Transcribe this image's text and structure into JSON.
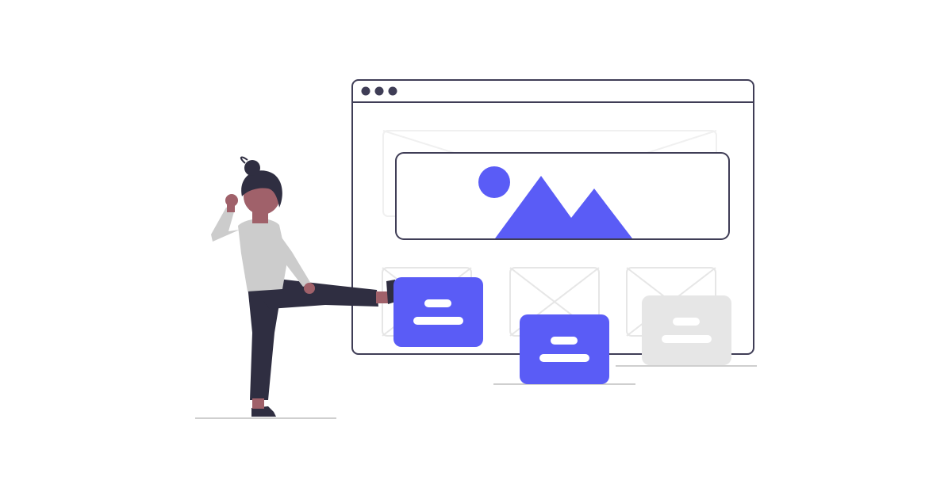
{
  "colors": {
    "background": "#ffffff",
    "accent": "#5a5cf6",
    "outline": "#3f3d56",
    "dark": "#2f2e41",
    "skin": "#a0616a",
    "shirt": "#cccccc",
    "card_inactive": "#e6e6e6",
    "ghost_lines": "#f0f0f0",
    "floor": "#cfcfcf"
  },
  "browser_window": {
    "dots": 3,
    "hero_image_icon": "image-placeholder-icon",
    "thumbnail_icon": "image-placeholder-x-icon"
  },
  "cards": [
    {
      "name": "card-kicked",
      "state": "active",
      "icon": "text-lines-icon"
    },
    {
      "name": "card-middle",
      "state": "active",
      "icon": "text-lines-icon"
    },
    {
      "name": "card-right",
      "state": "inactive",
      "icon": "text-lines-icon"
    }
  ],
  "figure": {
    "icon": "person-kicking-icon"
  }
}
